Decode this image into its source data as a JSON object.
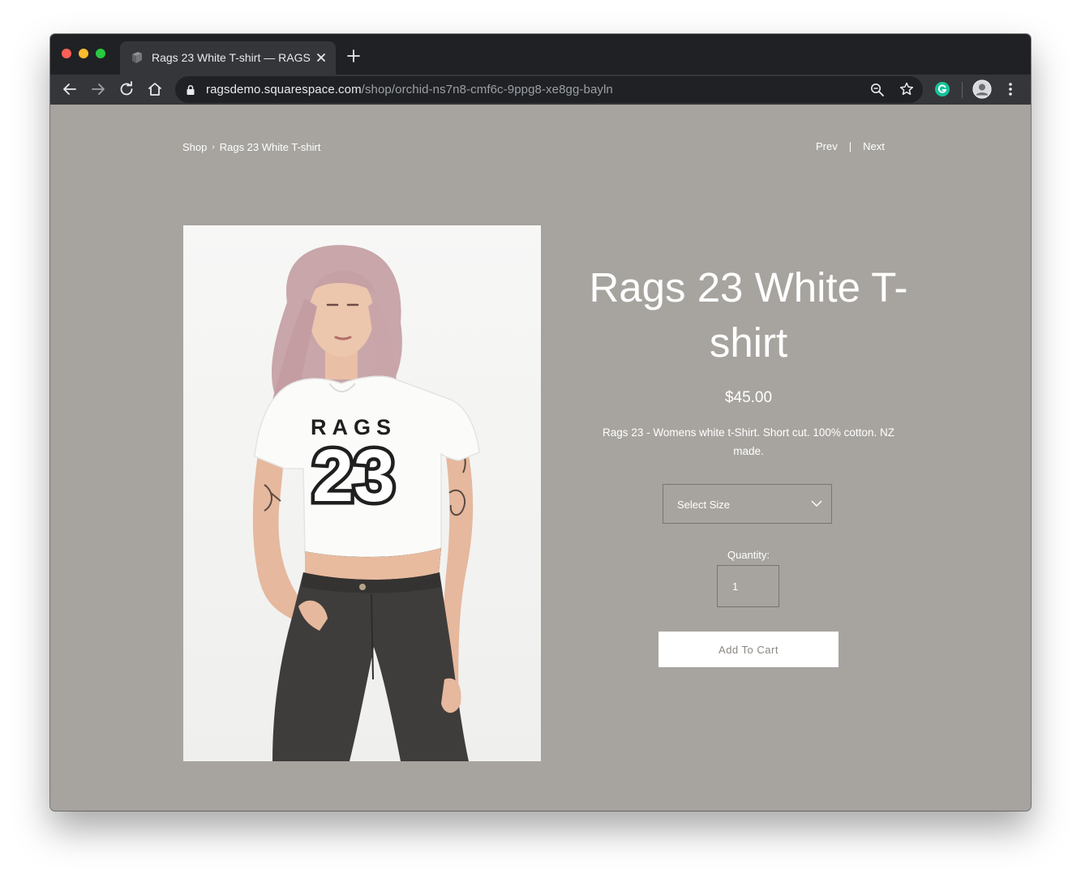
{
  "browser": {
    "tab_title": "Rags 23 White T-shirt — RAGS",
    "url_host": "ragsdemo.squarespace.com",
    "url_path": "/shop/orchid-ns7n8-cmf6c-9ppg8-xe8gg-bayln",
    "icons": [
      "back-icon",
      "forward-icon",
      "reload-icon",
      "home-icon",
      "lock-icon",
      "zoom-icon",
      "bookmark-star-icon",
      "grammarly-extension-icon",
      "profile-avatar",
      "menu-icon"
    ]
  },
  "breadcrumb": {
    "shop": "Shop",
    "separator": "›",
    "current": "Rags 23 White T-shirt"
  },
  "pager": {
    "prev": "Prev",
    "separator": "|",
    "next": "Next"
  },
  "product": {
    "title": "Rags 23 White T-shirt",
    "price": "$45.00",
    "description": "Rags 23 - Womens white t-Shirt. Short cut. 100% cotton. NZ made.",
    "image_print_top": "RAGS",
    "image_print_number": "23",
    "size_select_label": "Select Size",
    "quantity_label": "Quantity:",
    "quantity_value": "1",
    "add_to_cart": "Add To Cart"
  },
  "colors": {
    "page_background": "#a7a49f",
    "chrome_dark": "#202124",
    "chrome_toolbar": "#35363a",
    "button_text": "#8a8782"
  }
}
